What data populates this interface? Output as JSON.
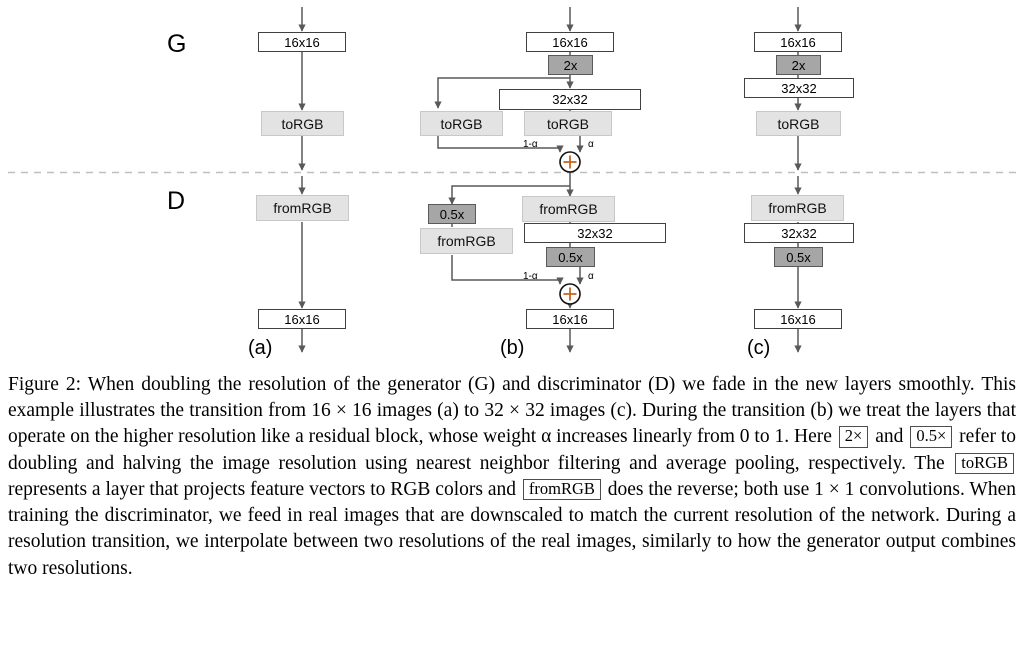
{
  "figure": {
    "side_labels": [
      {
        "id": "generator",
        "text": "G"
      },
      {
        "id": "discriminator",
        "text": "D"
      }
    ],
    "column_labels": [
      {
        "id": "a",
        "text": "(a)"
      },
      {
        "id": "b",
        "text": "(b)"
      },
      {
        "id": "c",
        "text": "(c)"
      }
    ],
    "blend_labels": {
      "left_weight": "1-α",
      "right_weight": "α",
      "operator": "+"
    },
    "colors": {
      "resolution_box_fill": "#ffffff",
      "resolution_box_border": "#404040",
      "rgb_box_fill": "#e3e3e3",
      "rgb_box_border": "#c8c8c8",
      "scale_box_fill": "#a6a6a6",
      "scale_box_border": "#5a5a5a",
      "arrow": "#595959",
      "divider": "#bfbfbf",
      "text": "#000000"
    },
    "columns": [
      {
        "id": "a",
        "generator_nodes": [
          {
            "name": "res-16-top",
            "label": "16x16",
            "kind": "resolution"
          },
          {
            "name": "torgb",
            "label": "toRGB",
            "kind": "rgb"
          }
        ],
        "discriminator_nodes": [
          {
            "name": "fromrgb",
            "label": "fromRGB",
            "kind": "rgb"
          },
          {
            "name": "res-16-bottom",
            "label": "16x16",
            "kind": "resolution"
          }
        ]
      },
      {
        "id": "b",
        "generator_nodes": [
          {
            "name": "res-16-top",
            "label": "16x16",
            "kind": "resolution"
          },
          {
            "name": "upscale",
            "label": "2x",
            "kind": "scale"
          },
          {
            "name": "res-32",
            "label": "32x32",
            "kind": "resolution"
          },
          {
            "name": "torgb-old",
            "label": "toRGB",
            "kind": "rgb"
          },
          {
            "name": "torgb-new",
            "label": "toRGB",
            "kind": "rgb"
          }
        ],
        "discriminator_nodes": [
          {
            "name": "fromrgb-new",
            "label": "fromRGB",
            "kind": "rgb"
          },
          {
            "name": "downscale-old",
            "label": "0.5x",
            "kind": "scale"
          },
          {
            "name": "fromrgb-old",
            "label": "fromRGB",
            "kind": "rgb"
          },
          {
            "name": "res-32",
            "label": "32x32",
            "kind": "resolution"
          },
          {
            "name": "downscale-new",
            "label": "0.5x",
            "kind": "scale"
          },
          {
            "name": "res-16-bottom",
            "label": "16x16",
            "kind": "resolution"
          }
        ]
      },
      {
        "id": "c",
        "generator_nodes": [
          {
            "name": "res-16-top",
            "label": "16x16",
            "kind": "resolution"
          },
          {
            "name": "upscale",
            "label": "2x",
            "kind": "scale"
          },
          {
            "name": "res-32",
            "label": "32x32",
            "kind": "resolution"
          },
          {
            "name": "torgb",
            "label": "toRGB",
            "kind": "rgb"
          }
        ],
        "discriminator_nodes": [
          {
            "name": "fromrgb",
            "label": "fromRGB",
            "kind": "rgb"
          },
          {
            "name": "res-32",
            "label": "32x32",
            "kind": "resolution"
          },
          {
            "name": "downscale",
            "label": "0.5x",
            "kind": "scale"
          },
          {
            "name": "res-16-bottom",
            "label": "16x16",
            "kind": "resolution"
          }
        ]
      }
    ]
  },
  "caption": {
    "label": "Figure 2:",
    "segment_1": " When doubling the resolution of the generator (G) and discriminator (D) we fade in the new layers smoothly. This example illustrates the transition from ",
    "math_16x16": "16 × 16",
    "segment_2": " images (a) to ",
    "math_32x32": "32 × 32",
    "segment_3": " images (c). During the transition (b) we treat the layers that operate on the higher resolution like a residual block, whose weight ",
    "math_alpha": "α",
    "segment_4": " increases linearly from 0 to 1. Here ",
    "box_2x": "2×",
    "segment_5": " and ",
    "box_05x": "0.5×",
    "segment_6": " refer to doubling and halving the image resolution using nearest neighbor filtering and average pooling, respectively. The ",
    "box_torgb": "toRGB",
    "segment_7": " represents a layer that projects feature vectors to RGB colors and ",
    "box_fromrgb": "fromRGB",
    "segment_8": " does the reverse; both use ",
    "math_1x1": "1 × 1",
    "segment_9": " convolutions. When training the discriminator, we feed in real images that are downscaled to match the current resolution of the network. During a resolution transition, we interpolate between two resolutions of the real images, similarly to how the generator output combines two resolutions."
  }
}
